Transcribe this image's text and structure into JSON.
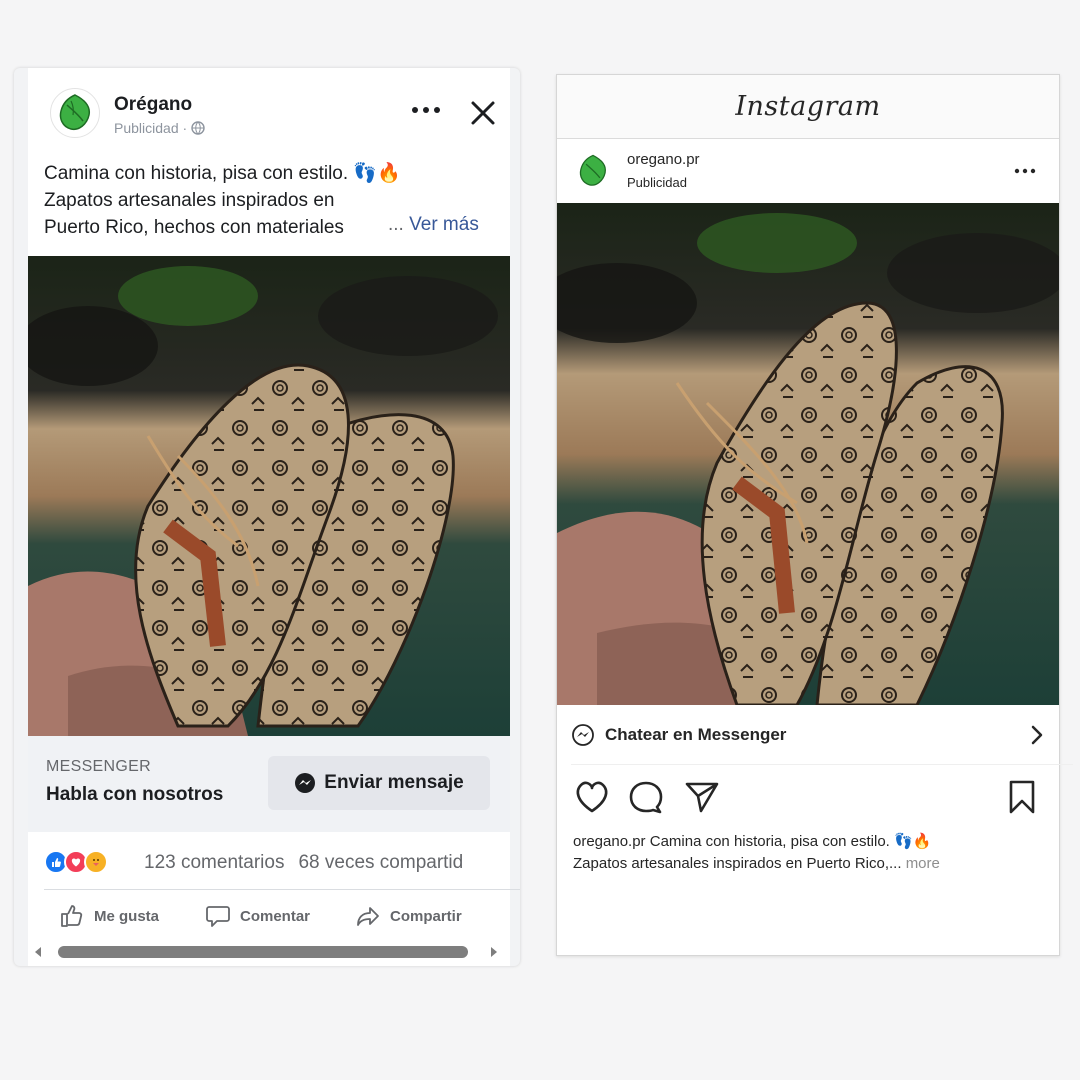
{
  "facebook": {
    "page_name": "Orégano",
    "sponsored": "Publicidad ·",
    "post_text_lines": [
      "Camina con historia, pisa con estilo. 👣🔥",
      "Zapatos artesanales inspirados en",
      "Puerto Rico, hechos con materiales"
    ],
    "see_more_prefix": "...",
    "see_more": "Ver más",
    "cta_kicker": "MESSENGER",
    "cta_title": "Habla con nosotros",
    "cta_button": "Enviar mensaje",
    "comments": "123 comentarios",
    "shares": "68 veces compartid",
    "actions": {
      "like": "Me gusta",
      "comment": "Comentar",
      "share": "Compartir"
    },
    "colors": {
      "like_blue": "#1877f2",
      "love_red": "#f33e58",
      "care_yellow": "#f7b125"
    }
  },
  "instagram": {
    "logo": "Instagram",
    "username": "oregano.pr",
    "sponsored": "Publicidad",
    "cta": "Chatear en Messenger",
    "caption_username": "oregano.pr",
    "caption_line1": "Camina con historia, pisa con estilo. 👣🔥",
    "caption_line2": "Zapatos artesanales inspirados en Puerto Rico,...",
    "more": "more"
  },
  "brand": {
    "green": "#4caf50"
  }
}
